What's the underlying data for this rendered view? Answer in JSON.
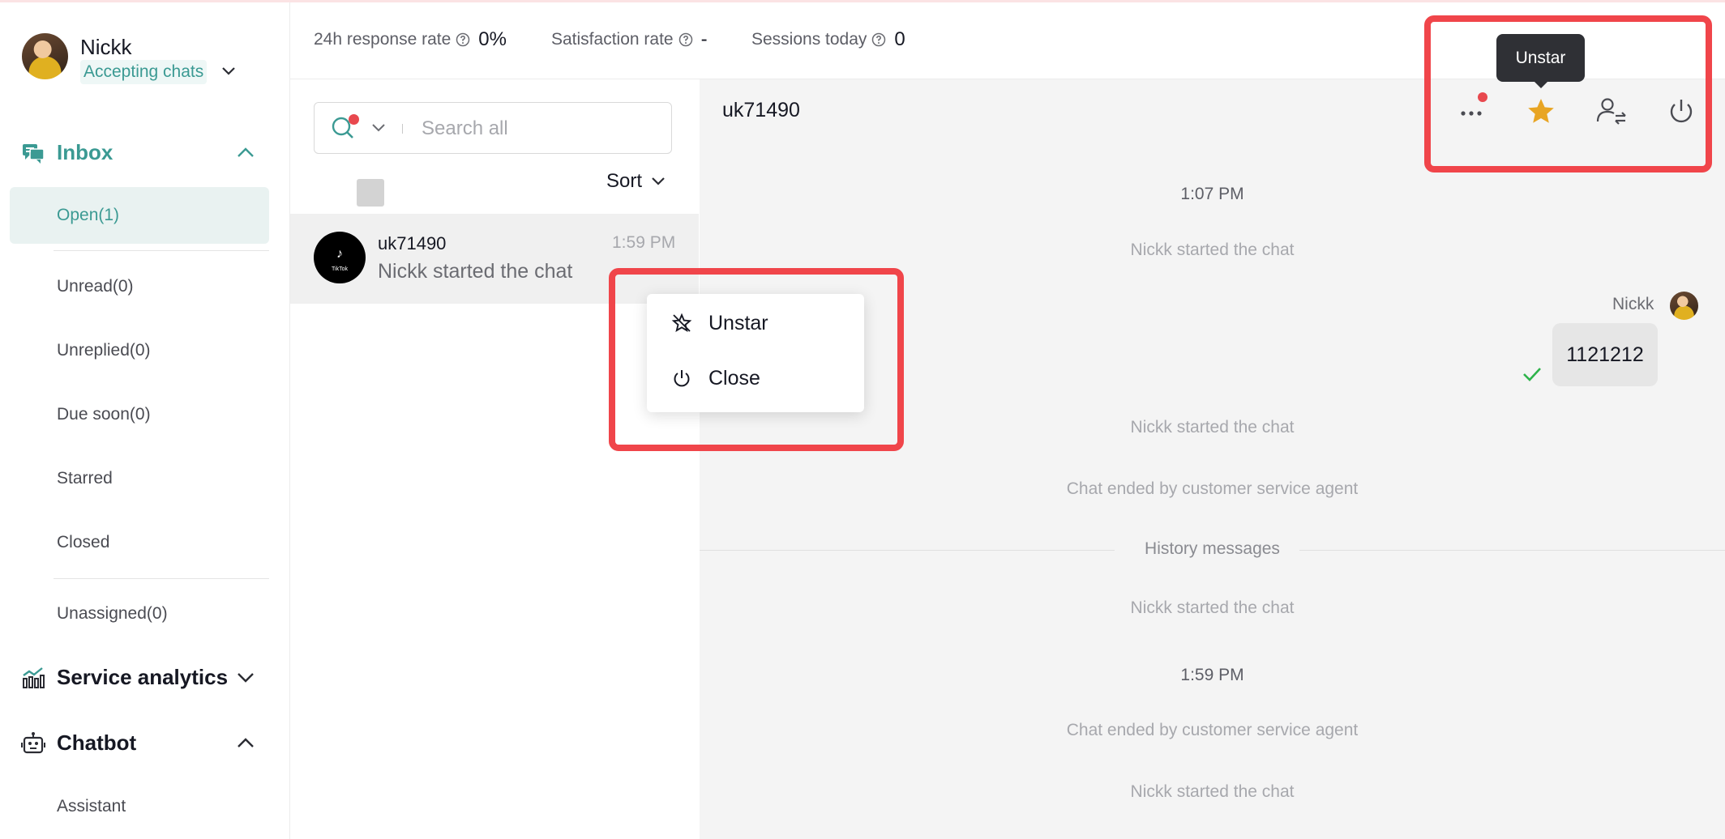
{
  "user": {
    "name": "Nickk",
    "status": "Accepting chats"
  },
  "sidebar": {
    "inbox_label": "Inbox",
    "items": [
      {
        "label": "Open(1)",
        "active": true
      },
      {
        "label": "Unread(0)"
      },
      {
        "label": "Unreplied(0)"
      },
      {
        "label": "Due soon(0)"
      },
      {
        "label": "Starred"
      },
      {
        "label": "Closed"
      },
      {
        "label": "Unassigned(0)"
      }
    ],
    "service_analytics_label": "Service analytics",
    "chatbot_label": "Chatbot",
    "chatbot_items": [
      {
        "label": "Assistant"
      }
    ]
  },
  "stats": [
    {
      "label": "24h response rate",
      "value": "0%"
    },
    {
      "label": "Satisfaction rate",
      "value": "-"
    },
    {
      "label": "Sessions today",
      "value": "0"
    }
  ],
  "search": {
    "placeholder": "Search all"
  },
  "sort_label": "Sort",
  "chat_list": [
    {
      "name": "uk71490",
      "time": "1:59 PM",
      "preview": "Nickk started the chat",
      "avatar_text": "TikTok"
    }
  ],
  "context_menu": {
    "items": [
      {
        "label": "Unstar",
        "icon": "unstar-icon"
      },
      {
        "label": "Close",
        "icon": "power-icon"
      }
    ]
  },
  "conversation": {
    "title": "uk71490",
    "tooltip": "Unstar",
    "messages": {
      "time1": "1:07 PM",
      "sys1": "Nickk started the chat",
      "agent_name": "Nickk",
      "bubble": "1121212",
      "sys2": "Nickk started the chat",
      "sys3": "Chat ended by customer service agent",
      "history": "History messages",
      "sys4": "Nickk started the chat",
      "time2": "1:59 PM",
      "sys5": "Chat ended by customer service agent",
      "sys6": "Nickk started the chat"
    }
  },
  "colors": {
    "accent": "#3b9a93",
    "star": "#e8a524",
    "highlight": "#f0454a",
    "notification": "#e8484e"
  }
}
